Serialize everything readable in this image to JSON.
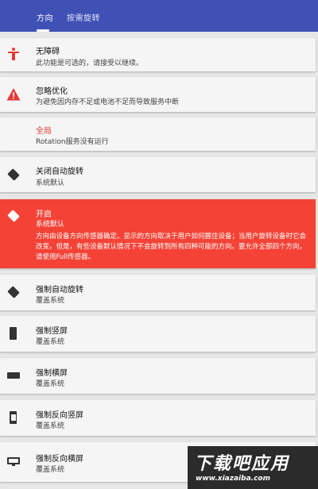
{
  "tabs": [
    {
      "label": "方向",
      "active": true
    },
    {
      "label": "按需旋转",
      "active": false
    }
  ],
  "colors": {
    "appbar": "#3f51b5",
    "accent_red": "#f44336",
    "warning_red": "#e53935"
  },
  "items": [
    {
      "icon": "accessibility-icon",
      "title": "无障碍",
      "subtitle": "此功能是可选的，请接受以继续。"
    },
    {
      "icon": "warning-icon",
      "title": "忽略优化",
      "subtitle": "为避免因内存不足或电池不足而导致服务中断"
    },
    {
      "icon": "",
      "title": "全局",
      "subtitle": "Rotation服务没有运行"
    },
    {
      "icon": "rotation-off-icon",
      "title": "关闭自动旋转",
      "subtitle": "系统默认"
    },
    {
      "icon": "rotation-on-icon",
      "title": "开启",
      "subtitle": "系统默认",
      "selected": true,
      "description": "方向由设备方向传感器确定。显示的方向取决于用户如何握住设备；当用户旋转设备时它会改变。但是，有些设备默认情况下不会旋转到所有四种可能的方向。要允许全部四个方向，请使用Full传感器。"
    },
    {
      "icon": "force-auto-rotate-icon",
      "title": "强制自动旋转",
      "subtitle": "覆盖系统"
    },
    {
      "icon": "portrait-icon",
      "title": "强制竖屏",
      "subtitle": "覆盖系统"
    },
    {
      "icon": "landscape-icon",
      "title": "强制横屏",
      "subtitle": "覆盖系统"
    },
    {
      "icon": "reverse-portrait-icon",
      "title": "强制反向竖屏",
      "subtitle": "覆盖系统"
    },
    {
      "icon": "reverse-landscape-icon",
      "title": "强制反向横屏",
      "subtitle": "覆盖系统"
    }
  ],
  "watermark": {
    "main": "下载吧应用",
    "url": "www.xiazaiba.com"
  }
}
